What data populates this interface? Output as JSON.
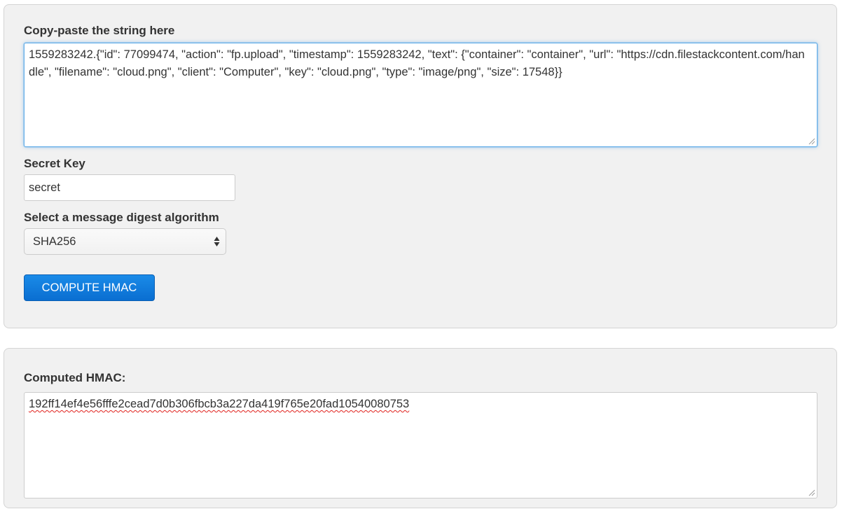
{
  "input_panel": {
    "string_label": "Copy-paste the string here",
    "string_value": "1559283242.{\"id\": 77099474, \"action\": \"fp.upload\", \"timestamp\": 1559283242, \"text\": {\"container\": \"container\", \"url\": \"https://cdn.filestackcontent.com/handle\", \"filename\": \"cloud.png\", \"client\": \"Computer\", \"key\": \"cloud.png\", \"type\": \"image/png\", \"size\": 17548}}",
    "secret_label": "Secret Key",
    "secret_value": "secret",
    "algorithm_label": "Select a message digest algorithm",
    "algorithm_selected": "SHA256",
    "compute_button_label": "COMPUTE HMAC"
  },
  "output_panel": {
    "result_label": "Computed HMAC:",
    "result_value": "192ff14ef4e56fffe2cead7d0b306fbcb3a227da419f765e20fad10540080753"
  },
  "colors": {
    "panel_background": "#f1f1f1",
    "focus_border": "#66afe9",
    "button_background": "#0a6ed1",
    "spellcheck_underline": "#e0211d"
  },
  "icons": {
    "resize": "resize-grip-icon",
    "select_arrows": "updown-arrows-icon"
  }
}
